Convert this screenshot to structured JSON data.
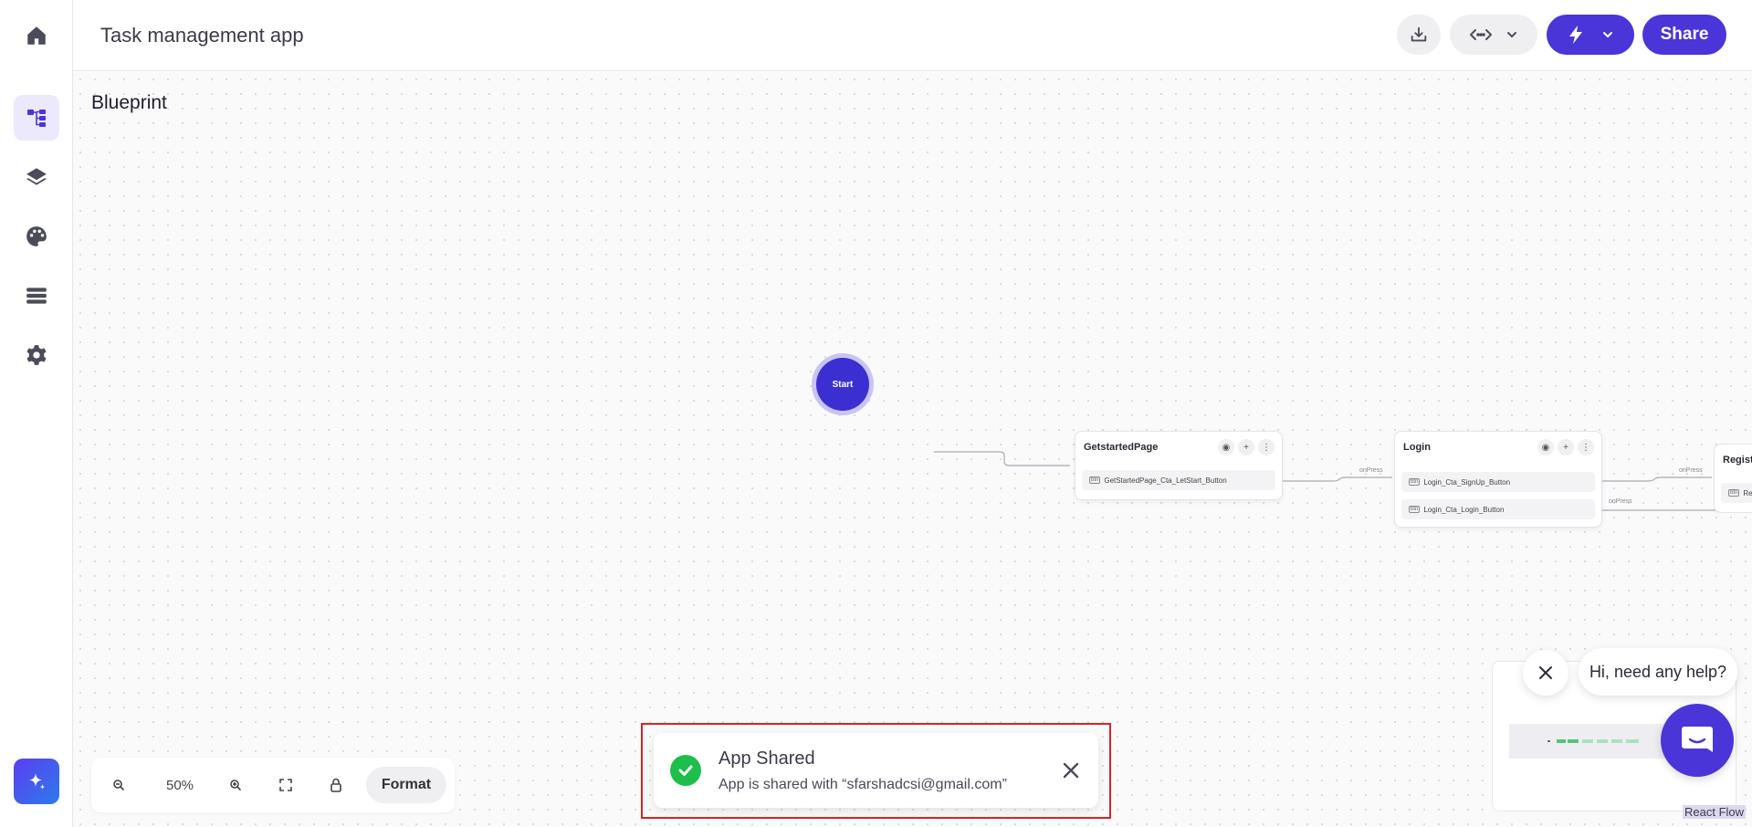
{
  "header": {
    "app_title": "Task management app",
    "share_label": "Share"
  },
  "sidebar": {
    "items": [
      {
        "name": "home-icon"
      },
      {
        "name": "blueprint-icon",
        "active": true
      },
      {
        "name": "layers-icon"
      },
      {
        "name": "palette-icon"
      },
      {
        "name": "database-icon"
      },
      {
        "name": "gear-icon"
      },
      {
        "name": "sparkle-icon"
      }
    ]
  },
  "canvas": {
    "title": "Blueprint"
  },
  "flow": {
    "start_label": "Start",
    "nodes": [
      {
        "title": "GetstartedPage",
        "rows": [
          "GetStartedPage_Cta_LetStart_Button"
        ]
      },
      {
        "title": "Login",
        "rows": [
          "Login_Cta_SignUp_Button",
          "Login_Cta_Login_Button"
        ]
      },
      {
        "title": "Registe",
        "rows": [
          "Regi"
        ]
      }
    ],
    "edge_labels": [
      "onPress",
      "onPress",
      "onPress"
    ],
    "row_tag": "btn"
  },
  "toolbar": {
    "zoom_level": "50%",
    "format_label": "Format"
  },
  "toast": {
    "title": "App Shared",
    "message": "App is shared with “sfarshadcsi@gmail.com”"
  },
  "help": {
    "bubble_text": "Hi, need any help?"
  },
  "minimap": {
    "attribution": "React Flow"
  },
  "colors": {
    "accent": "#4a35d8",
    "success": "#1dbf4a",
    "highlight": "#d8232a"
  }
}
